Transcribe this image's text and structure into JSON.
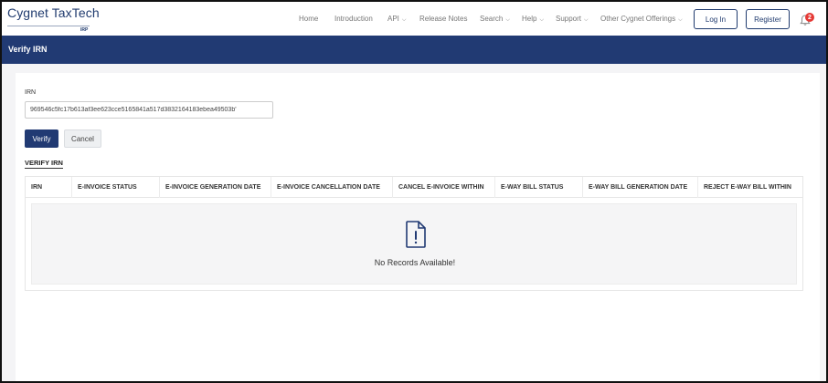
{
  "brand": {
    "name": "Cygnet TaxTech",
    "sub": "IRP"
  },
  "nav": {
    "items": [
      {
        "label": "Home",
        "caret": ""
      },
      {
        "label": "Introduction",
        "caret": ""
      },
      {
        "label": "API",
        "caret": "⌵"
      },
      {
        "label": "Release Notes",
        "caret": ""
      },
      {
        "label": "Search",
        "caret": "⌵"
      },
      {
        "label": "Help",
        "caret": "⌵"
      },
      {
        "label": "Support",
        "caret": "⌵"
      },
      {
        "label": "Other Cygnet Offerings",
        "caret": "⌵"
      }
    ],
    "login_label": "Log In",
    "register_label": "Register",
    "notification_count": "2"
  },
  "page": {
    "title": "Verify IRN"
  },
  "form": {
    "irn_label": "IRN",
    "irn_value": "969546c5fc17b613af3ee623cce5165841a517d3832164183ebea49503b'",
    "verify_label": "Verify",
    "cancel_label": "Cancel"
  },
  "results": {
    "section_title": "VERIFY IRN",
    "columns": [
      "IRN",
      "E-INVOICE STATUS",
      "E-INVOICE GENERATION DATE",
      "E-INVOICE CANCELLATION DATE",
      "CANCEL E-INVOICE WITHIN",
      "E-WAY BILL STATUS",
      "E-WAY BILL GENERATION DATE",
      "REJECT E-WAY BILL WITHIN"
    ],
    "empty_text": "No Records Available!"
  },
  "colors": {
    "primary": "#213a73",
    "badge": "#e53935"
  },
  "icons": {
    "notification": "bell-icon",
    "empty": "file-alert-icon"
  }
}
